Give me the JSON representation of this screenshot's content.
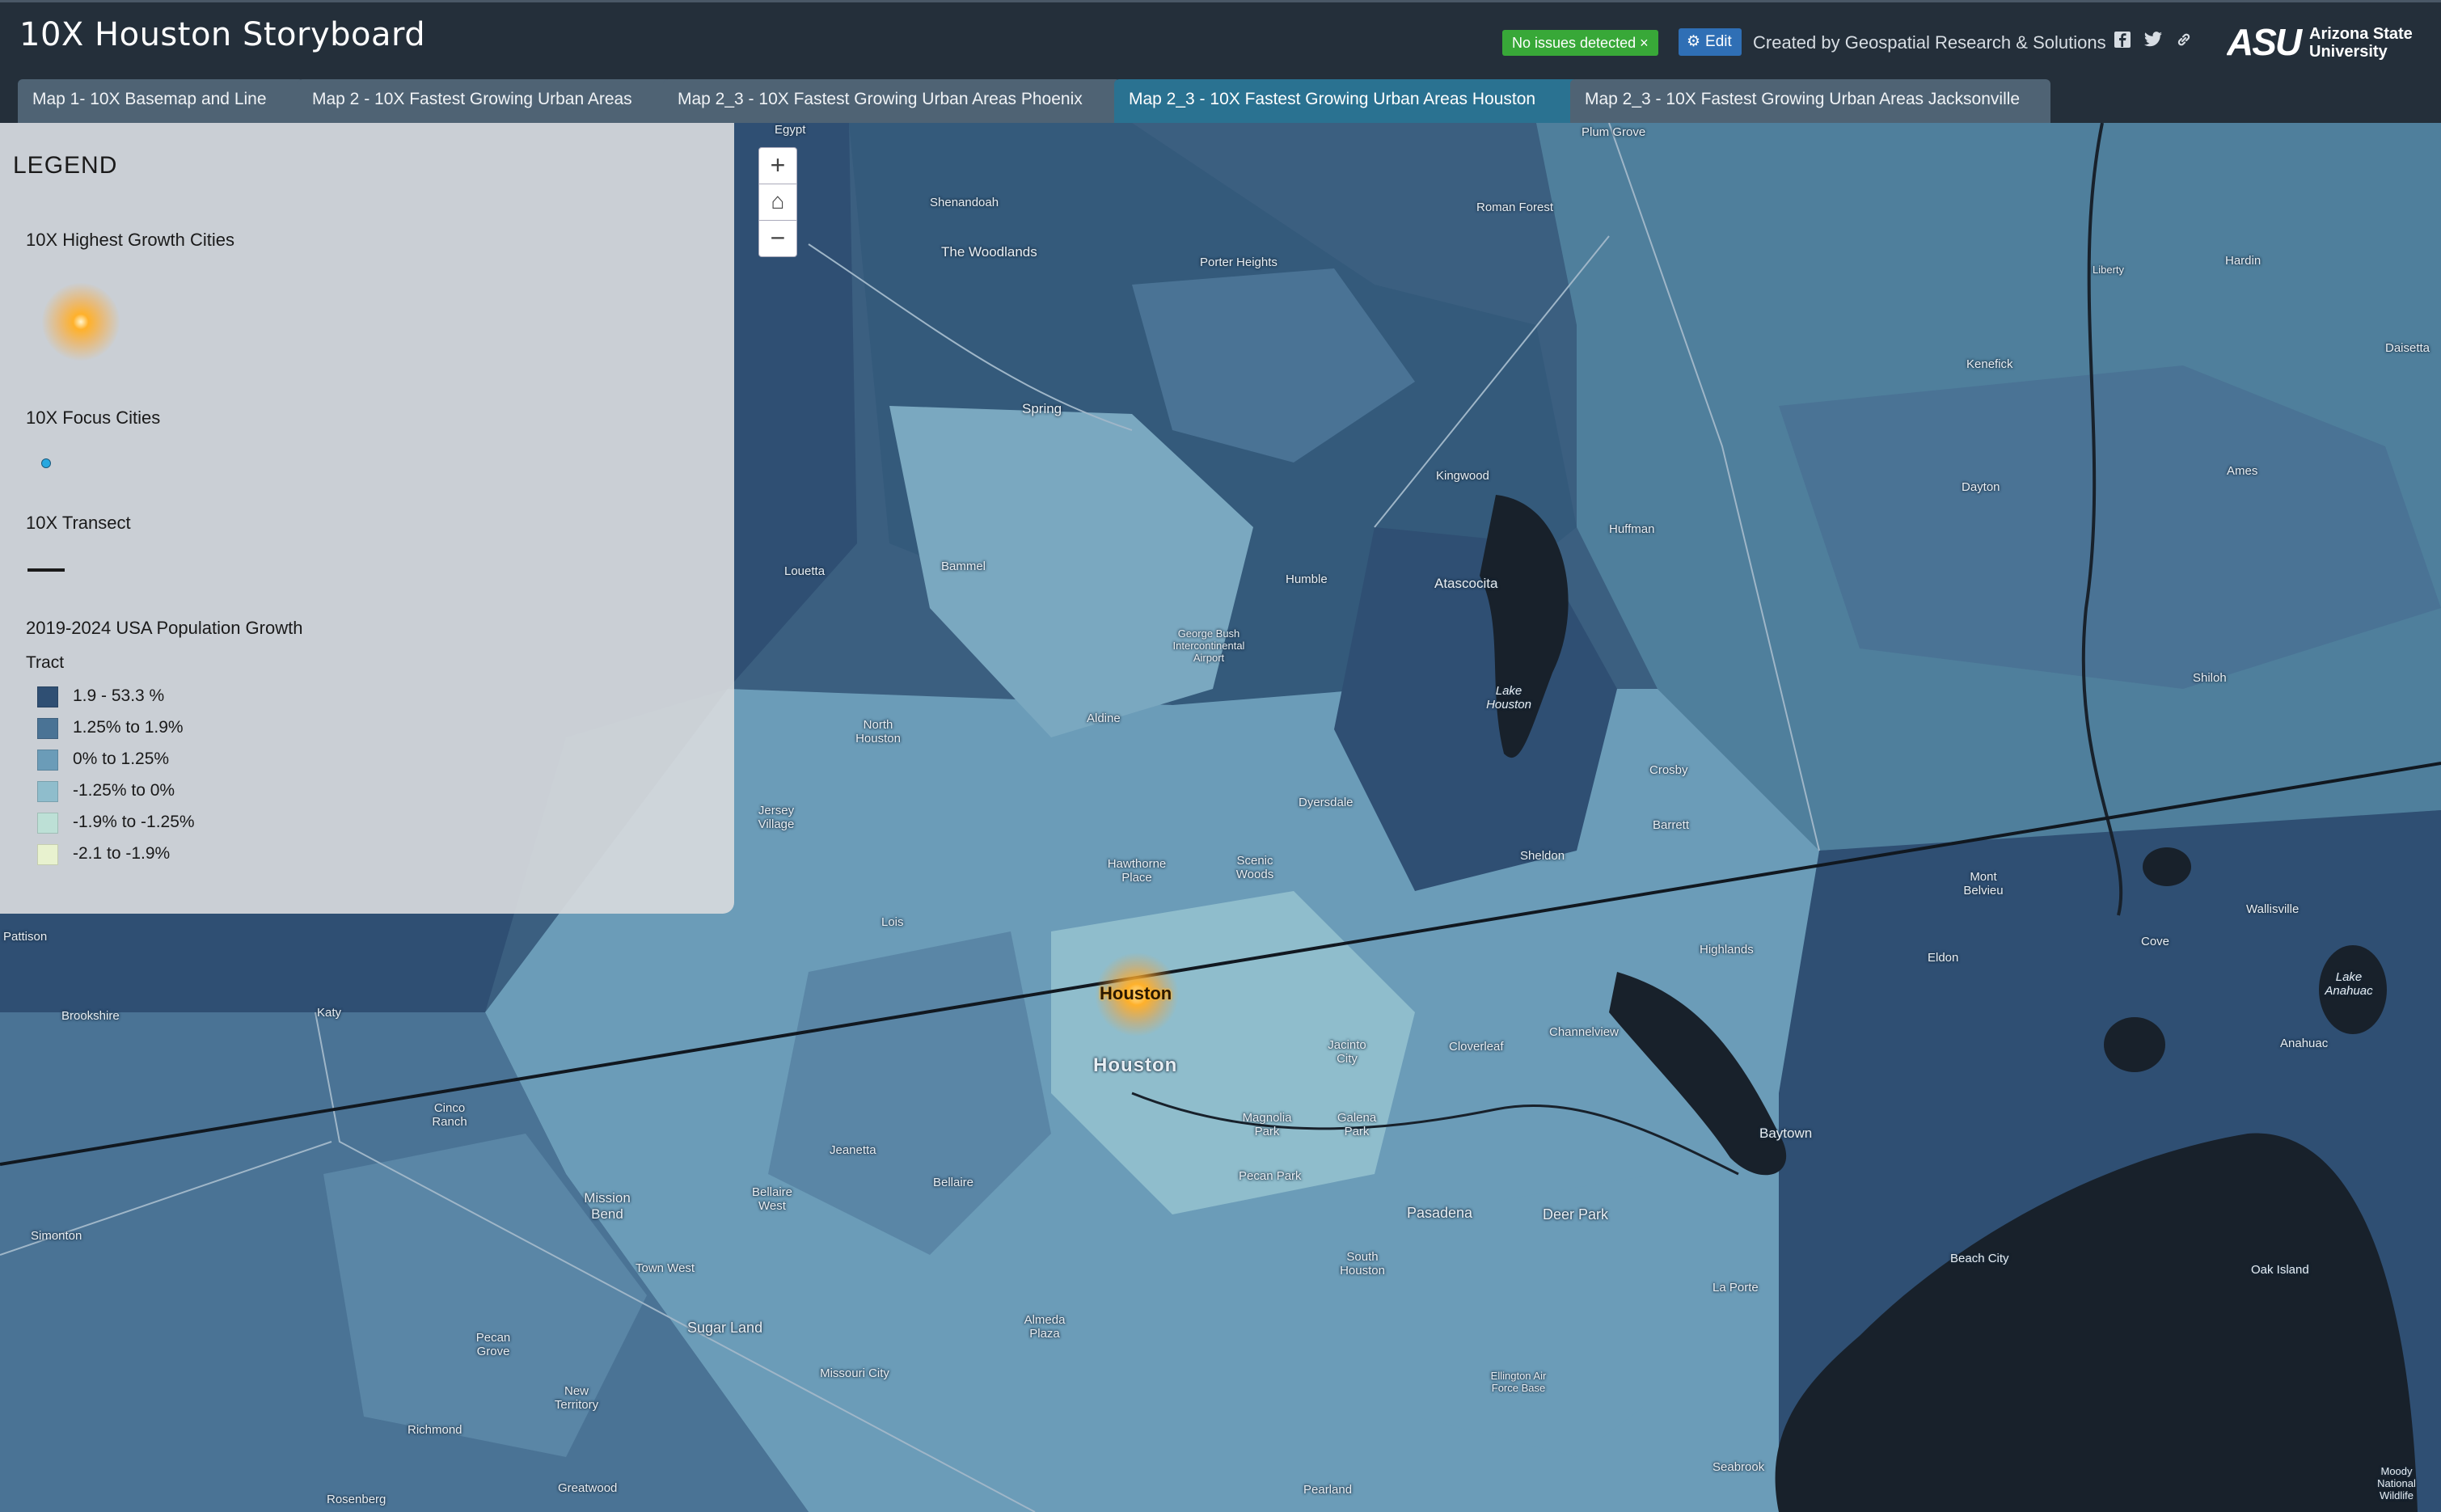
{
  "header": {
    "title": "10X Houston Storyboard",
    "status_badge": "No issues detected ×",
    "edit_label": "Edit",
    "credits": "Created by Geospatial Research & Solutions",
    "social": [
      "facebook-icon",
      "twitter-icon",
      "link-icon"
    ],
    "logo_text_1": "Arizona State",
    "logo_text_2": "University",
    "logo_mark": "ASU"
  },
  "tabs": [
    {
      "label": "Map 1- 10X Basemap and Line",
      "active": false
    },
    {
      "label": "Map 2 - 10X Fastest Growing Urban Areas",
      "active": false
    },
    {
      "label": "Map 2_3 - 10X Fastest Growing Urban Areas Phoenix",
      "active": false
    },
    {
      "label": "Map 2_3 - 10X Fastest Growing Urban Areas Houston",
      "active": true
    },
    {
      "label": "Map 2_3 - 10X Fastest Growing Urban Areas Jacksonville",
      "active": false
    }
  ],
  "legend": {
    "title": "LEGEND",
    "growth_cities_heading": "10X Highest Growth Cities",
    "focus_cities_heading": "10X Focus Cities",
    "transect_heading": "10X Transect",
    "population_heading": "2019-2024 USA Population Growth",
    "population_sub": "Tract",
    "classes": [
      {
        "label": "1.9 - 53.3 %",
        "color": "#2f4f73"
      },
      {
        "label": "1.25% to 1.9%",
        "color": "#4a7395"
      },
      {
        "label": "0% to 1.25%",
        "color": "#6b9cb8"
      },
      {
        "label": "-1.25% to 0%",
        "color": "#8fbdcc"
      },
      {
        "label": "-1.9% to -1.25%",
        "color": "#bde0d6"
      },
      {
        "label": "-2.1 to -1.9%",
        "color": "#e8f2cf"
      }
    ]
  },
  "map_controls": {
    "zoom_in": "+",
    "home": "⌂",
    "zoom_out": "−"
  },
  "map_labels": {
    "houston_major": "Houston",
    "houston_city": "Houston",
    "places": [
      "Egypt",
      "Plum Grove",
      "Shenandoah",
      "The Woodlands",
      "Porter Heights",
      "Roman Forest",
      "Spring",
      "Kingwood",
      "Huffman",
      "Atascocita",
      "Humble",
      "Louetta",
      "Bammel",
      "George Bush Intercontinental Airport",
      "Lake Houston",
      "Aldine",
      "North Houston",
      "Crosby",
      "Barrett",
      "Jersey Village",
      "Dyersdale",
      "Hawthorne Place",
      "Scenic Woods",
      "Sheldon",
      "Lois",
      "Highlands",
      "Channelview",
      "Cloverleaf",
      "Jacinto City",
      "Katy",
      "Brookshire",
      "Pattison",
      "Cinco Ranch",
      "Jeanetta",
      "Mission Bend",
      "Bellaire West",
      "Bellaire",
      "Magnolia Park",
      "Galena Park",
      "Pecan Park",
      "Pasadena",
      "Deer Park",
      "Baytown",
      "South Houston",
      "Simonton",
      "Town West",
      "Sugar Land",
      "Almeda Plaza",
      "Missouri City",
      "Pecan Grove",
      "New Territory",
      "Richmond",
      "Rosenberg",
      "Greatwood",
      "Pearland",
      "Seabrook",
      "La Porte",
      "Beach City",
      "Ellington Air Force Base",
      "Liberty",
      "Hardin",
      "Kenefick",
      "Dayton",
      "Ames",
      "Daisetta",
      "Shiloh",
      "Mont Belvieu",
      "Wallisville",
      "Eldon",
      "Cove",
      "Lake Anahuac",
      "Anahuac",
      "Oak Island",
      "Moody National Wildlife"
    ]
  }
}
